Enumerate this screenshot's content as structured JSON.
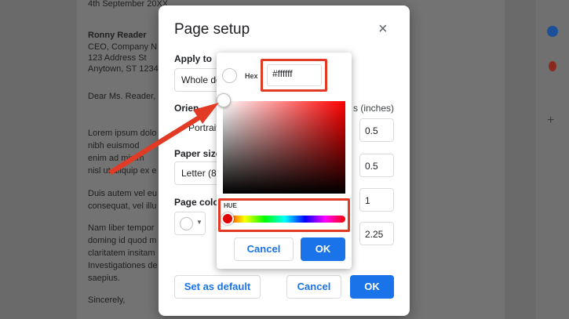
{
  "document": {
    "lines": [
      "4th September 20XX",
      "Ronny Reader",
      "CEO, Company N",
      "123 Address St",
      "Anytown, ST 1234",
      "Dear Ms. Reader,",
      "Lorem ipsum dolo",
      "nibh euismod",
      "enim ad minim",
      "nisl ut aliquip ex e",
      "Duis autem vel eu",
      "consequat, vel illu",
      "Nam liber tempor",
      "doming id quod m",
      "claritatem insitam",
      "Investigationes de",
      "saepius.",
      "Sincerely,"
    ]
  },
  "dialog": {
    "title": "Page setup",
    "close_icon": "close-icon",
    "apply_to_label": "Apply to",
    "apply_to_value": "Whole do",
    "orientation_label": "Orien",
    "orientation_value": "Portrait",
    "margins_label": "s (inches)",
    "margins": [
      "0.5",
      "0.5",
      "1",
      "2.25"
    ],
    "paper_size_label": "Paper size",
    "paper_size_value": "Letter (8.5",
    "page_color_label": "Page color",
    "set_default_label": "Set as default",
    "cancel_label": "Cancel",
    "ok_label": "OK"
  },
  "picker": {
    "hex_label": "Hex",
    "hex_value": "#ffffff",
    "hue_label": "HUE",
    "cancel_label": "Cancel",
    "ok_label": "OK"
  },
  "colors": {
    "accent": "#1a73e8",
    "highlight": "#e23b25"
  }
}
